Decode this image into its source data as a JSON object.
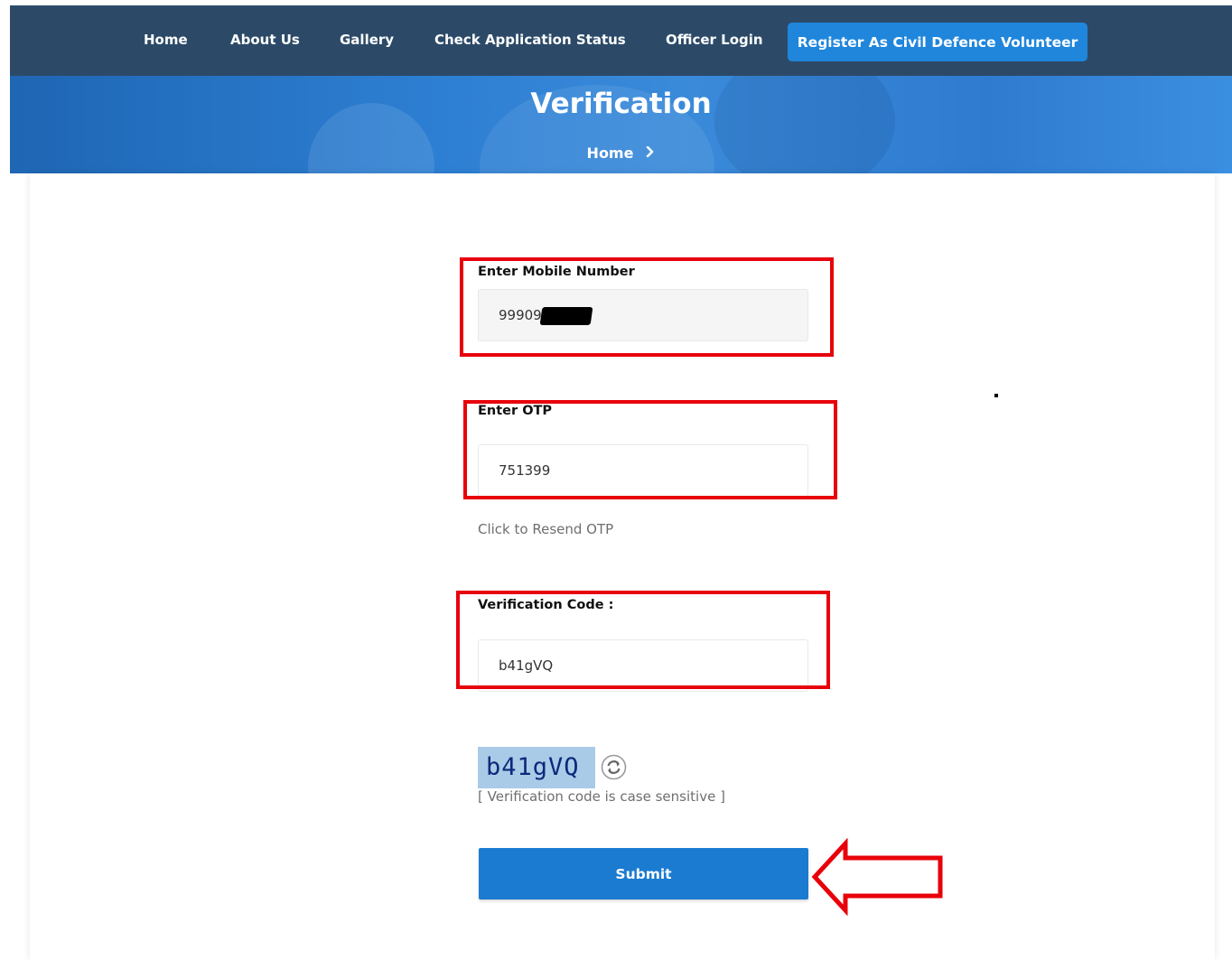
{
  "nav": {
    "items": [
      "Home",
      "About Us",
      "Gallery",
      "Check Application Status",
      "Officer Login"
    ],
    "cta": "Register As Civil Defence Volunteer"
  },
  "hero": {
    "title": "Verification",
    "breadcrumb": "Home"
  },
  "form": {
    "mobile_label": "Enter Mobile Number",
    "mobile_value": "99909",
    "otp_label": "Enter OTP",
    "otp_value": "751399",
    "resend_text": "Click to Resend OTP",
    "code_label": "Verification Code :",
    "code_value": "b41gVQ",
    "captcha_text": "b41gVQ",
    "captcha_note": "[ Verification code is case sensitive ]",
    "submit_label": "Submit"
  },
  "colors": {
    "nav_bg": "#2c4a68",
    "accent": "#1b7bd1",
    "highlight": "#e8000a"
  },
  "icons": {
    "refresh": "refresh-icon",
    "breadcrumb_separator": "chevron-right-icon",
    "annotation_arrow": "arrow-left-icon"
  }
}
